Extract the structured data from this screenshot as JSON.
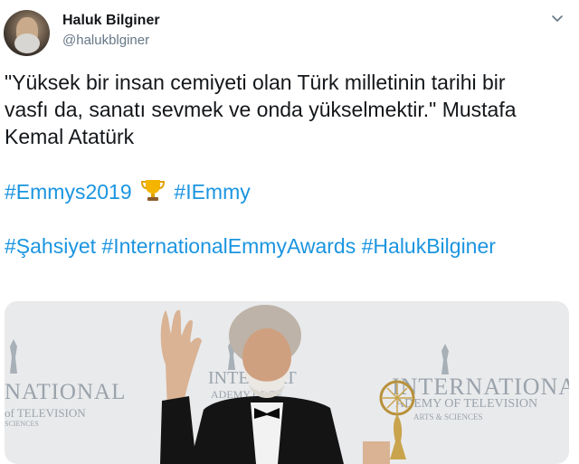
{
  "user": {
    "name": "Haluk Bilginer",
    "handle": "@halukblginer"
  },
  "tweet": {
    "quote_line1": "\"Yüksek bir insan cemiyeti olan Türk milletinin tarihi bir",
    "quote_line2": "vasfı da, sanatı sevmek ve onda yükselmektir.\" Mustafa",
    "quote_line3": "Kemal Atatürk",
    "hashtags_line1": [
      "#Emmys2019",
      "#IEmmy"
    ],
    "hashtags_line2": [
      "#Şahsiyet",
      "#InternationalEmmyAwards",
      "#HalukBilginer"
    ]
  },
  "photo": {
    "backdrop_left": "NATIONAL",
    "backdrop_left_sub": "of TELEVISION",
    "backdrop_left_sub2": "SCIENCES",
    "backdrop_mid": "INTERNAT",
    "backdrop_mid_sub": "ADEMY OF TE",
    "backdrop_right": "INTERNATIONAL",
    "backdrop_right_sub": "ADEMY OF TELEVISION",
    "backdrop_right_sub2": "ARTS & SCIENCES"
  },
  "colors": {
    "link": "#1b95e0",
    "secondary": "#657786",
    "text": "#14171a"
  },
  "icons": {
    "menu": "chevron-down-icon",
    "emoji": "trophy-icon"
  }
}
